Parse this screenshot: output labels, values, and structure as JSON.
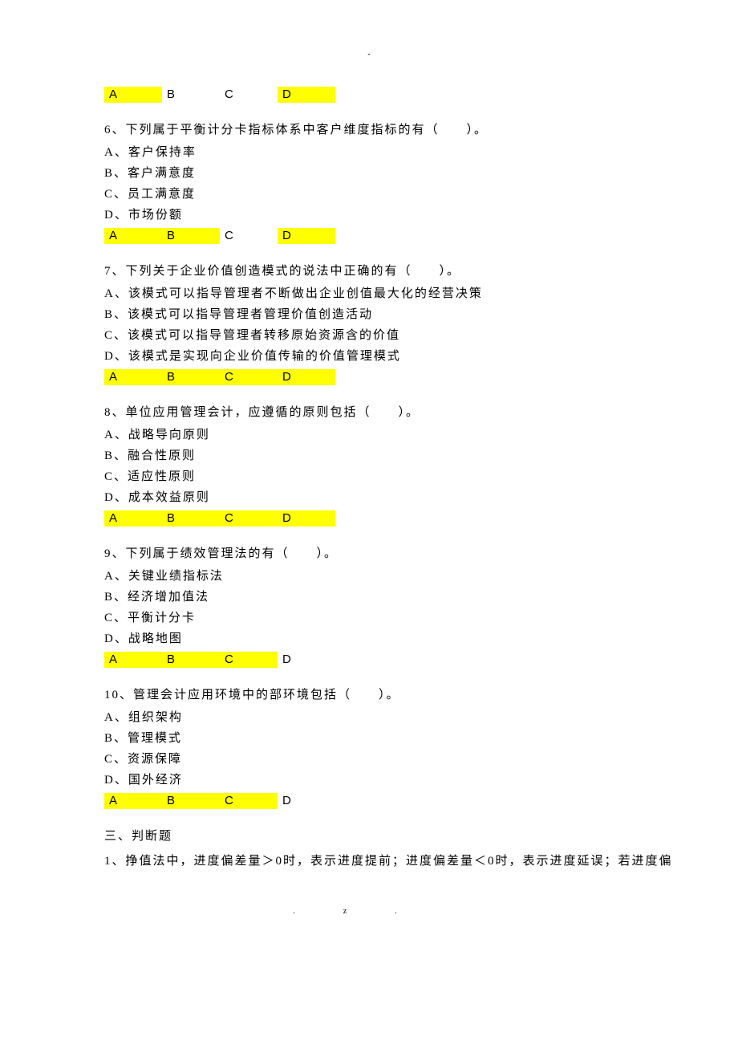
{
  "top_mark": "-",
  "q5_answers": {
    "a": "A",
    "b": "B",
    "c": "C",
    "d": "D",
    "hl": [
      "a",
      "d"
    ]
  },
  "q6": {
    "stem": "6、下列属于平衡计分卡指标体系中客户维度指标的有（　　）。",
    "opts": {
      "a": "A、客户保持率",
      "b": "B、客户满意度",
      "c": "C、员工满意度",
      "d": "D、市场份额"
    },
    "ans": {
      "a": "A",
      "b": "B",
      "c": "C",
      "d": "D"
    },
    "hl": [
      "a",
      "b",
      "d"
    ]
  },
  "q7": {
    "stem": "7、下列关于企业价值创造模式的说法中正确的有（　　）。",
    "opts": {
      "a": "A、该模式可以指导管理者不断做出企业创值最大化的经营决策",
      "b": "B、该模式可以指导管理者管理价值创造活动",
      "c": "C、该模式可以指导管理者转移原始资源含的价值",
      "d": "D、该模式是实现向企业价值传输的价值管理模式"
    },
    "ans": {
      "a": "A",
      "b": "B",
      "c": "C",
      "d": "D"
    },
    "hl": [
      "a",
      "b",
      "c",
      "d"
    ]
  },
  "q8": {
    "stem": "8、单位应用管理会计，应遵循的原则包括（　　）。",
    "opts": {
      "a": "A、战略导向原则",
      "b": "B、融合性原则",
      "c": "C、适应性原则",
      "d": "D、成本效益原则"
    },
    "ans": {
      "a": "A",
      "b": "B",
      "c": "C",
      "d": "D"
    },
    "hl": [
      "a",
      "b",
      "c",
      "d"
    ]
  },
  "q9": {
    "stem": "9、下列属于绩效管理法的有（　　）。",
    "opts": {
      "a": "A、关键业绩指标法",
      "b": "B、经济增加值法",
      "c": "C、平衡计分卡",
      "d": "D、战略地图"
    },
    "ans": {
      "a": "A",
      "b": "B",
      "c": "C",
      "d": "D"
    },
    "hl": [
      "a",
      "b",
      "c"
    ]
  },
  "q10": {
    "stem": "10、管理会计应用环境中的部环境包括（　　）。",
    "opts": {
      "a": "A、组织架构",
      "b": "B、管理模式",
      "c": "C、资源保障",
      "d": "D、国外经济"
    },
    "ans": {
      "a": "A",
      "b": "B",
      "c": "C",
      "d": "D"
    },
    "hl": [
      "a",
      "b",
      "c"
    ]
  },
  "section3_title": "三、判断题",
  "judge1": "1、挣值法中，进度偏差量＞0时，表示进度提前；进度偏差量＜0时，表示进度延误；若进度偏",
  "footer": ".z."
}
